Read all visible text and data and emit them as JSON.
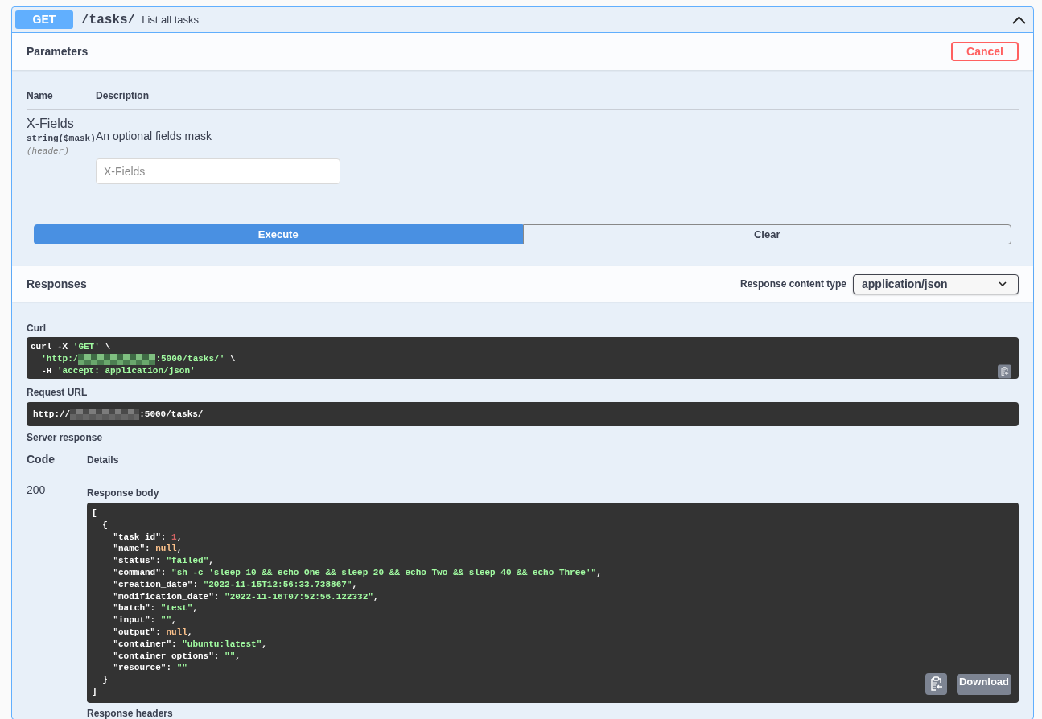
{
  "operation": {
    "method": "GET",
    "path": "/tasks/",
    "summary": "List all tasks",
    "expanded": true
  },
  "parameters": {
    "title": "Parameters",
    "cancel_button": "Cancel",
    "columns": [
      "Name",
      "Description"
    ],
    "rows": [
      {
        "name": "X-Fields",
        "type": "string($mask)",
        "location": "(header)",
        "description": "An optional fields mask",
        "input": {
          "placeholder": "X-Fields"
        }
      }
    ]
  },
  "actions": [
    {
      "label": "Execute",
      "kind": "primary"
    },
    {
      "label": "Clear",
      "kind": "secondary"
    }
  ],
  "responses": {
    "title": "Responses",
    "content_type_label": "Response content type",
    "content_type": "application/json",
    "curl": {
      "label": "Curl",
      "lines": [
        [
          {
            "kind": "plain",
            "text": "curl -X "
          },
          {
            "kind": "string",
            "text": "'GET'"
          },
          {
            "kind": "plain",
            "text": " \\"
          }
        ],
        [
          {
            "kind": "string",
            "text": "  'http:/"
          },
          {
            "kind": "redacted"
          },
          {
            "kind": "string",
            "text": ":5000/tasks/'"
          },
          {
            "kind": "plain",
            "text": " \\"
          }
        ],
        [
          {
            "kind": "plain",
            "text": "  -H "
          },
          {
            "kind": "string",
            "text": "'accept: application/json'"
          }
        ]
      ]
    },
    "request_url": {
      "label": "Request URL",
      "tokens": [
        {
          "kind": "plain",
          "text": "http://"
        },
        {
          "kind": "redacted"
        },
        {
          "kind": "plain",
          "text": ":5000/tasks/"
        }
      ]
    },
    "server_response": {
      "label": "Server response",
      "columns": [
        "Code",
        "Details"
      ],
      "code": "200",
      "body_label": "Response body",
      "body_lines": [
        [
          {
            "kind": "plain",
            "text": "["
          }
        ],
        [
          {
            "kind": "plain",
            "text": "  {"
          }
        ],
        [
          {
            "kind": "plain",
            "text": "    \"task_id\": "
          },
          {
            "kind": "number",
            "text": "1"
          },
          {
            "kind": "plain",
            "text": ","
          }
        ],
        [
          {
            "kind": "plain",
            "text": "    \"name\": "
          },
          {
            "kind": "null",
            "text": "null"
          },
          {
            "kind": "plain",
            "text": ","
          }
        ],
        [
          {
            "kind": "plain",
            "text": "    \"status\": "
          },
          {
            "kind": "string",
            "text": "\"failed\""
          },
          {
            "kind": "plain",
            "text": ","
          }
        ],
        [
          {
            "kind": "plain",
            "text": "    \"command\": "
          },
          {
            "kind": "string",
            "text": "\"sh -c 'sleep 10 && echo One && sleep 20 && echo Two && sleep 40 && echo Three'\""
          },
          {
            "kind": "plain",
            "text": ","
          }
        ],
        [
          {
            "kind": "plain",
            "text": "    \"creation_date\": "
          },
          {
            "kind": "string",
            "text": "\"2022-11-15T12:56:33.738867\""
          },
          {
            "kind": "plain",
            "text": ","
          }
        ],
        [
          {
            "kind": "plain",
            "text": "    \"modification_date\": "
          },
          {
            "kind": "string",
            "text": "\"2022-11-16T07:52:56.122332\""
          },
          {
            "kind": "plain",
            "text": ","
          }
        ],
        [
          {
            "kind": "plain",
            "text": "    \"batch\": "
          },
          {
            "kind": "string",
            "text": "\"test\""
          },
          {
            "kind": "plain",
            "text": ","
          }
        ],
        [
          {
            "kind": "plain",
            "text": "    \"input\": "
          },
          {
            "kind": "string",
            "text": "\"\""
          },
          {
            "kind": "plain",
            "text": ","
          }
        ],
        [
          {
            "kind": "plain",
            "text": "    \"output\": "
          },
          {
            "kind": "null",
            "text": "null"
          },
          {
            "kind": "plain",
            "text": ","
          }
        ],
        [
          {
            "kind": "plain",
            "text": "    \"container\": "
          },
          {
            "kind": "string",
            "text": "\"ubuntu:latest\""
          },
          {
            "kind": "plain",
            "text": ","
          }
        ],
        [
          {
            "kind": "plain",
            "text": "    \"container_options\": "
          },
          {
            "kind": "string",
            "text": "\"\""
          },
          {
            "kind": "plain",
            "text": ","
          }
        ],
        [
          {
            "kind": "plain",
            "text": "    \"resource\": "
          },
          {
            "kind": "string",
            "text": "\"\""
          }
        ],
        [
          {
            "kind": "plain",
            "text": "  }"
          }
        ],
        [
          {
            "kind": "plain",
            "text": "]"
          }
        ]
      ],
      "download_button": "Download",
      "headers_label": "Response headers"
    }
  }
}
